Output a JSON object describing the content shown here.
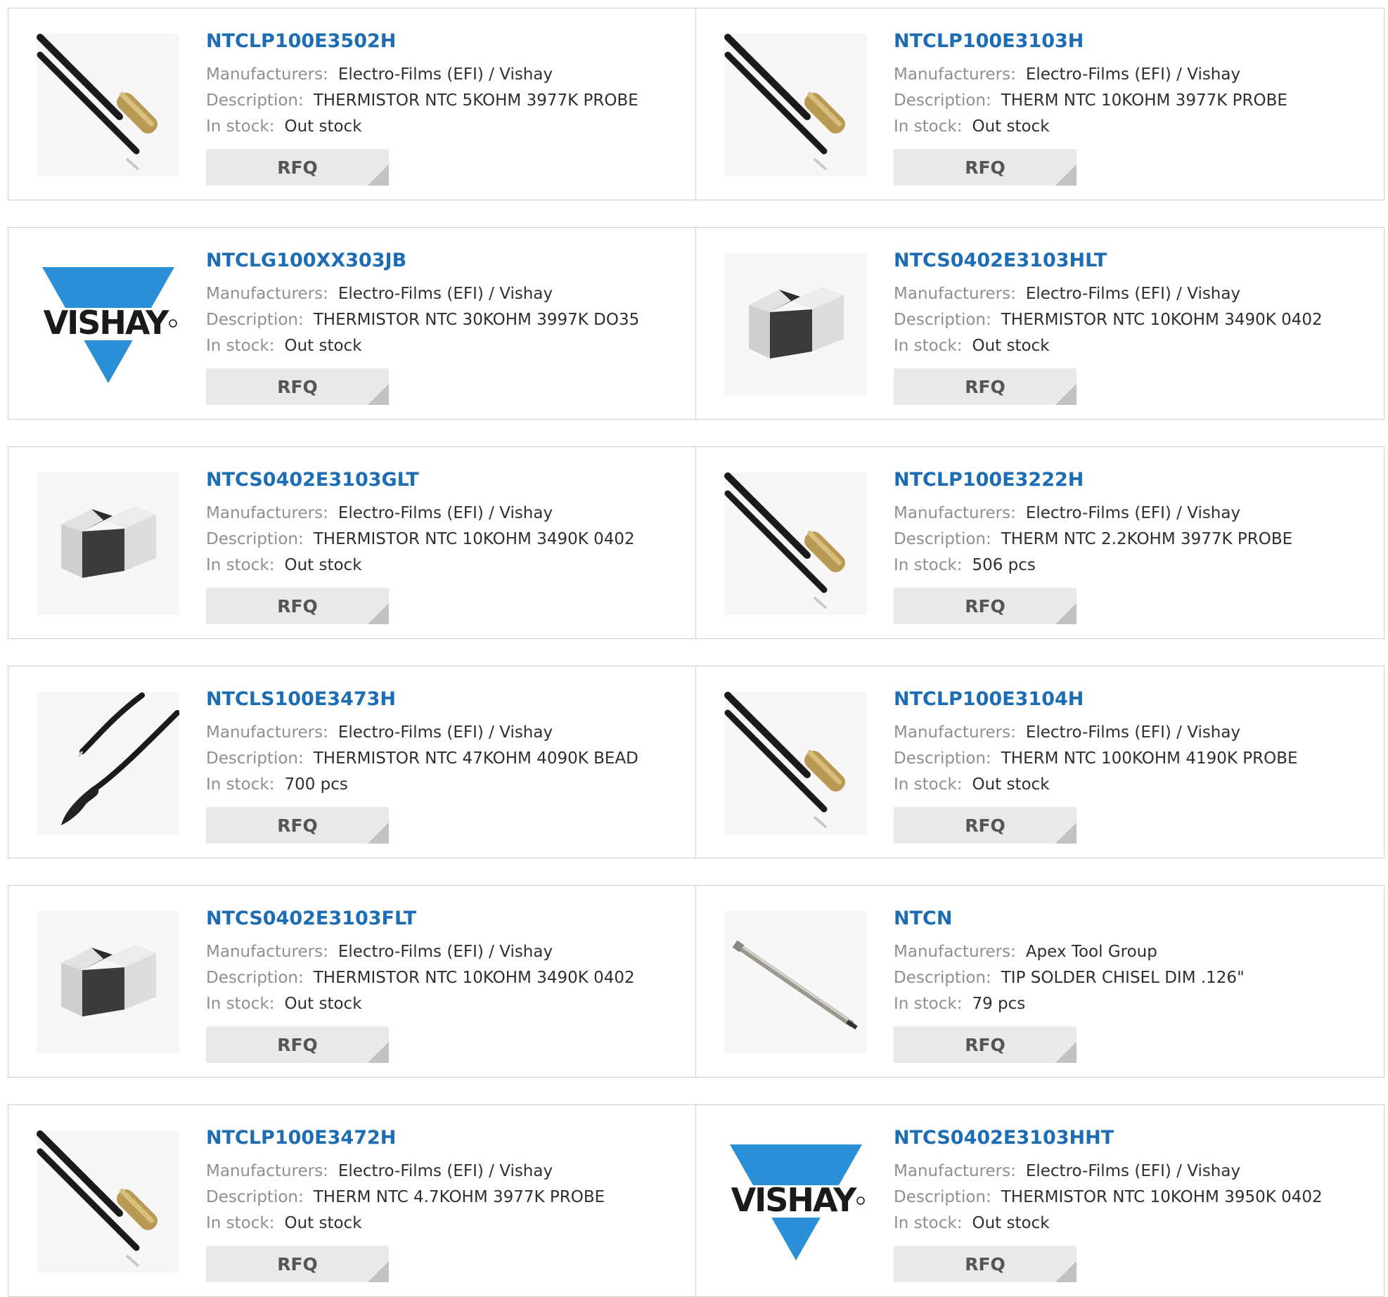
{
  "labels": {
    "manufacturers": "Manufacturers:",
    "description": "Description:",
    "in_stock": "In stock:",
    "rfq": "RFQ"
  },
  "colors": {
    "link": "#1d6db4",
    "label": "#8f8f8f",
    "value": "#2f2f2f",
    "button_bg": "#e9e9e9",
    "button_corner": "#c2c2c2",
    "vishay_blue": "#2a8fd6"
  },
  "products": [
    {
      "part": "NTCLP100E3502H",
      "manufacturer": "Electro-Films (EFI) / Vishay",
      "description": "THERMISTOR NTC 5KOHM 3977K PROBE",
      "stock": "Out stock",
      "image": "probe-sensor-icon"
    },
    {
      "part": "NTCLP100E3103H",
      "manufacturer": "Electro-Films (EFI) / Vishay",
      "description": "THERM NTC 10KOHM 3977K PROBE",
      "stock": "Out stock",
      "image": "probe-sensor-icon"
    },
    {
      "part": "NTCLG100XX303JB",
      "manufacturer": "Electro-Films (EFI) / Vishay",
      "description": "THERMISTOR NTC 30KOHM 3997K DO35",
      "stock": "Out stock",
      "image": "vishay-logo",
      "logo_text": "VISHAY"
    },
    {
      "part": "NTCS0402E3103HLT",
      "manufacturer": "Electro-Films (EFI) / Vishay",
      "description": "THERMISTOR NTC 10KOHM 3490K 0402",
      "stock": "Out stock",
      "image": "smd-chip-icon"
    },
    {
      "part": "NTCS0402E3103GLT",
      "manufacturer": "Electro-Films (EFI) / Vishay",
      "description": "THERMISTOR NTC 10KOHM 3490K 0402",
      "stock": "Out stock",
      "image": "smd-chip-icon"
    },
    {
      "part": "NTCLP100E3222H",
      "manufacturer": "Electro-Films (EFI) / Vishay",
      "description": "THERM NTC 2.2KOHM 3977K PROBE",
      "stock": "506 pcs",
      "image": "probe-sensor-icon"
    },
    {
      "part": "NTCLS100E3473H",
      "manufacturer": "Electro-Films (EFI) / Vishay",
      "description": "THERMISTOR NTC 47KOHM 4090K BEAD",
      "stock": "700 pcs",
      "image": "bead-sensor-icon"
    },
    {
      "part": "NTCLP100E3104H",
      "manufacturer": "Electro-Films (EFI) / Vishay",
      "description": "THERM NTC 100KOHM 4190K PROBE",
      "stock": "Out stock",
      "image": "probe-sensor-icon"
    },
    {
      "part": "NTCS0402E3103FLT",
      "manufacturer": "Electro-Films (EFI) / Vishay",
      "description": "THERMISTOR NTC 10KOHM 3490K 0402",
      "stock": "Out stock",
      "image": "smd-chip-icon"
    },
    {
      "part": "NTCN",
      "manufacturer": "Apex Tool Group",
      "description": "TIP SOLDER CHISEL DIM .126\"",
      "stock": "79 pcs",
      "image": "solder-tip-icon"
    },
    {
      "part": "NTCLP100E3472H",
      "manufacturer": "Electro-Films (EFI) / Vishay",
      "description": "THERM NTC 4.7KOHM 3977K PROBE",
      "stock": "Out stock",
      "image": "probe-sensor-icon"
    },
    {
      "part": "NTCS0402E3103HHT",
      "manufacturer": "Electro-Films (EFI) / Vishay",
      "description": "THERMISTOR NTC 10KOHM 3950K 0402",
      "stock": "Out stock",
      "image": "vishay-logo",
      "logo_text": "VISHAY"
    }
  ]
}
